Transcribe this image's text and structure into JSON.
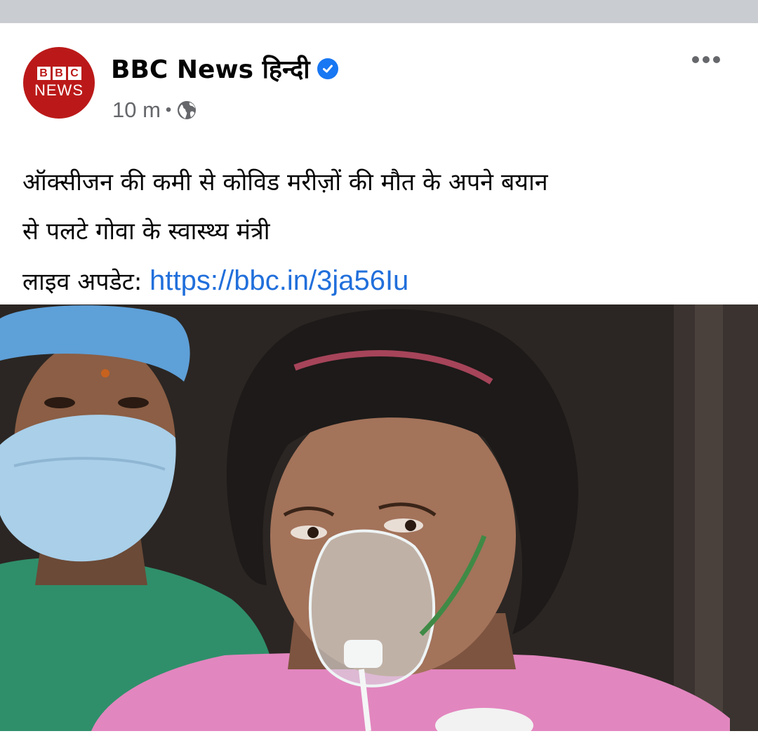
{
  "post": {
    "avatar": {
      "logo_letters": [
        "B",
        "B",
        "C"
      ],
      "logo_word": "NEWS",
      "icon": "bbc-news-logo"
    },
    "page_name": "BBC News हिन्दी",
    "verified_icon": "verified-badge-icon",
    "timestamp": "10 m",
    "separator": "•",
    "privacy_icon": "globe-icon",
    "more_icon": "more-options-icon",
    "text_line_1": "ऑक्सीजन की कमी से कोविड मरीज़ों की मौत के अपने बयान",
    "text_line_2": "से पलटे गोवा के स्वास्थ्य मंत्री",
    "live_label": "लाइव अपडेट:",
    "link": "https://bbc.in/3ja56Iu",
    "image": {
      "subject": "photo of a patient wearing an oxygen mask beside a health worker in a face mask"
    }
  },
  "colors": {
    "bbc_red": "#bb1919",
    "link_blue": "#216fdb",
    "verified_blue": "#1877f2",
    "meta_gray": "#65676b",
    "top_strip": "#c9ccd1"
  }
}
